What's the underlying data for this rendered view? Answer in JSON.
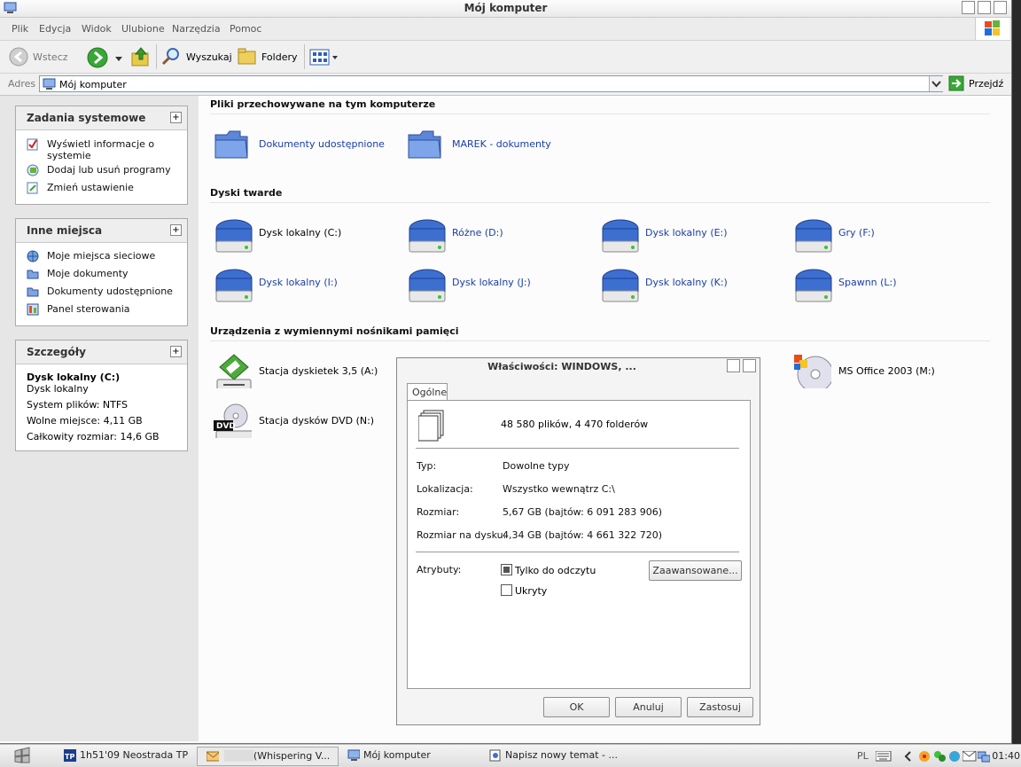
{
  "window": {
    "title": "Mój komputer"
  },
  "menu": [
    "Plik",
    "Edycja",
    "Widok",
    "Ulubione",
    "Narzędzia",
    "Pomoc"
  ],
  "toolbar": {
    "back": "Wstecz",
    "search": "Wyszukaj",
    "folders": "Foldery"
  },
  "address": {
    "label": "Adres",
    "value": "Mój komputer",
    "go": "Przejdź"
  },
  "tasks": {
    "system": {
      "title": "Zadania systemowe",
      "items": [
        "Wyświetl informacje o systemie",
        "Dodaj lub usuń programy",
        "Zmień ustawienie"
      ]
    },
    "places": {
      "title": "Inne miejsca",
      "items": [
        "Moje miejsca sieciowe",
        "Moje dokumenty",
        "Dokumenty udostępnione",
        "Panel sterowania"
      ]
    },
    "details": {
      "title": "Szczegóły",
      "name": "Dysk lokalny (C:)",
      "type": "Dysk lokalny",
      "fs": "System plików: NTFS",
      "free": "Wolne miejsce: 4,11 GB",
      "total": "Całkowity rozmiar: 14,6 GB"
    }
  },
  "sections": {
    "stored": {
      "title": "Pliki przechowywane na tym komputerze",
      "items": [
        "Dokumenty udostępnione",
        "MAREK - dokumenty"
      ]
    },
    "drives": {
      "title": "Dyski twarde",
      "items": [
        "Dysk lokalny (C:)",
        "Różne (D:)",
        "Dysk lokalny (E:)",
        "Gry (F:)",
        "Dysk lokalny (I:)",
        "Dysk lokalny (J:)",
        "Dysk lokalny (K:)",
        "Spawnn (L:)"
      ]
    },
    "removable": {
      "title": "Urządzenia z wymiennymi nośnikami pamięci",
      "items": [
        "Stacja dyskietek 3,5 (A:)",
        "Stacja dysków DVD (N:)",
        "MS Office 2003 (M:)"
      ],
      "dvd_badge": "DVD"
    }
  },
  "dialog": {
    "title": "Właściwości: WINDOWS, ...",
    "tab": "Ogólne",
    "summary": "48 580 plików, 4 470 folderów",
    "props": [
      {
        "label": "Typ:",
        "value": "Dowolne typy"
      },
      {
        "label": "Lokalizacja:",
        "value": "Wszystko wewnątrz C:\\"
      },
      {
        "label": "Rozmiar:",
        "value": "5,67 GB (bajtów: 6 091 283 906)"
      },
      {
        "label": "Rozmiar na dysku:",
        "value": "4,34 GB (bajtów: 4 661 322 720)"
      }
    ],
    "attributes_label": "Atrybuty:",
    "readonly": "Tylko do odczytu",
    "hidden": "Ukryty",
    "advanced": "Zaawansowane...",
    "ok": "OK",
    "cancel": "Anuluj",
    "apply": "Zastosuj"
  },
  "taskbar": {
    "items": [
      "1h51'09 Neostrada TP",
      "(Whispering V...",
      "Mój komputer",
      "Napisz nowy temat - ..."
    ],
    "items_prefix_censored": "████",
    "lang": "PL",
    "clock": "01:40"
  },
  "colors": {
    "link": "#1a3ea5",
    "drive_blue": "#3d6fd1",
    "folder_blue": "#5c86d8"
  }
}
